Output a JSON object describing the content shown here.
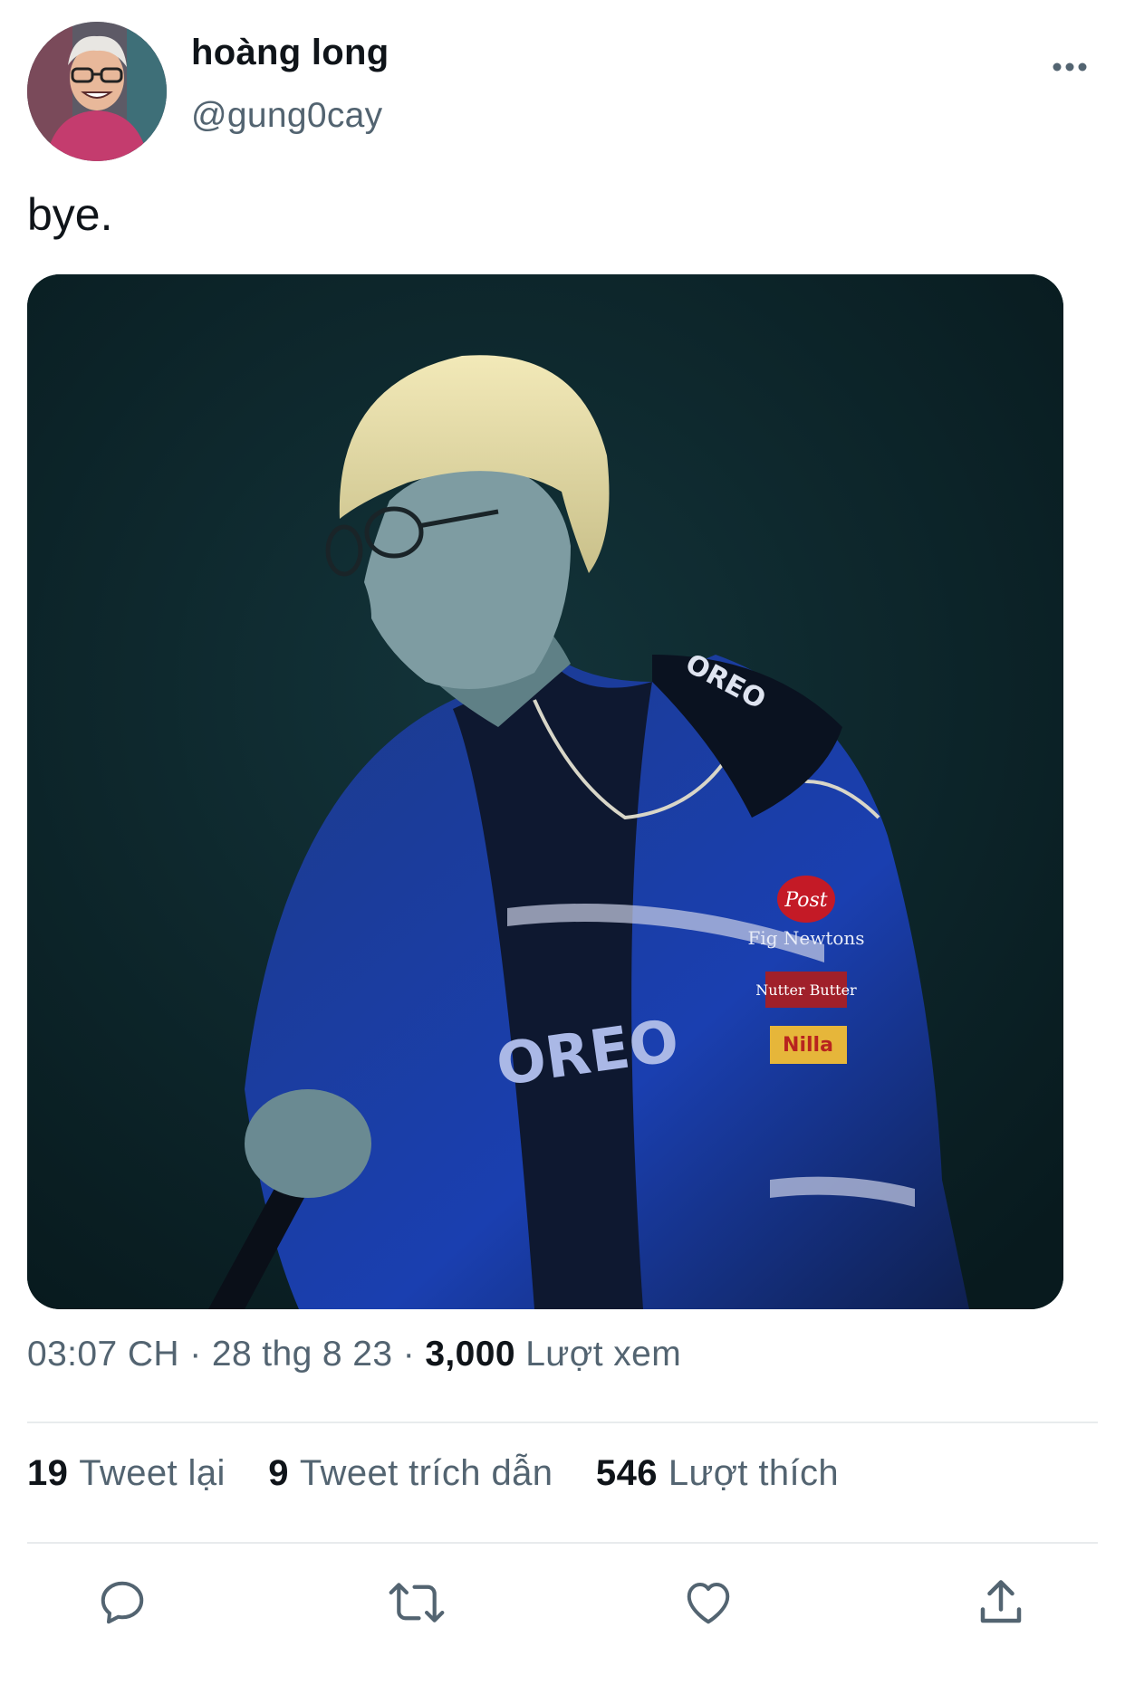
{
  "user": {
    "display_name": "hoàng long",
    "handle": "@gung0cay",
    "avatar_icon": "profile-photo"
  },
  "tweet": {
    "text": "bye."
  },
  "media": {
    "jersey_texts": [
      "OREO",
      "Post",
      "Fig Newtons",
      "Nutter Butter",
      "Nilla",
      "OREO"
    ]
  },
  "meta": {
    "time": "03:07 CH",
    "separator": "·",
    "date": "28 thg 8 23",
    "views_count": "3,000",
    "views_label": "Lượt xem"
  },
  "stats": {
    "retweets_count": "19",
    "retweets_label": "Tweet lại",
    "quotes_count": "9",
    "quotes_label": "Tweet trích dẫn",
    "likes_count": "546",
    "likes_label": "Lượt thích"
  },
  "icons": {
    "more": "more-horizontal-icon",
    "reply": "reply-icon",
    "retweet": "retweet-icon",
    "like": "heart-icon",
    "share": "share-icon"
  },
  "colors": {
    "text": "#0f1419",
    "secondary": "#536471",
    "divider": "#e8ebed"
  }
}
